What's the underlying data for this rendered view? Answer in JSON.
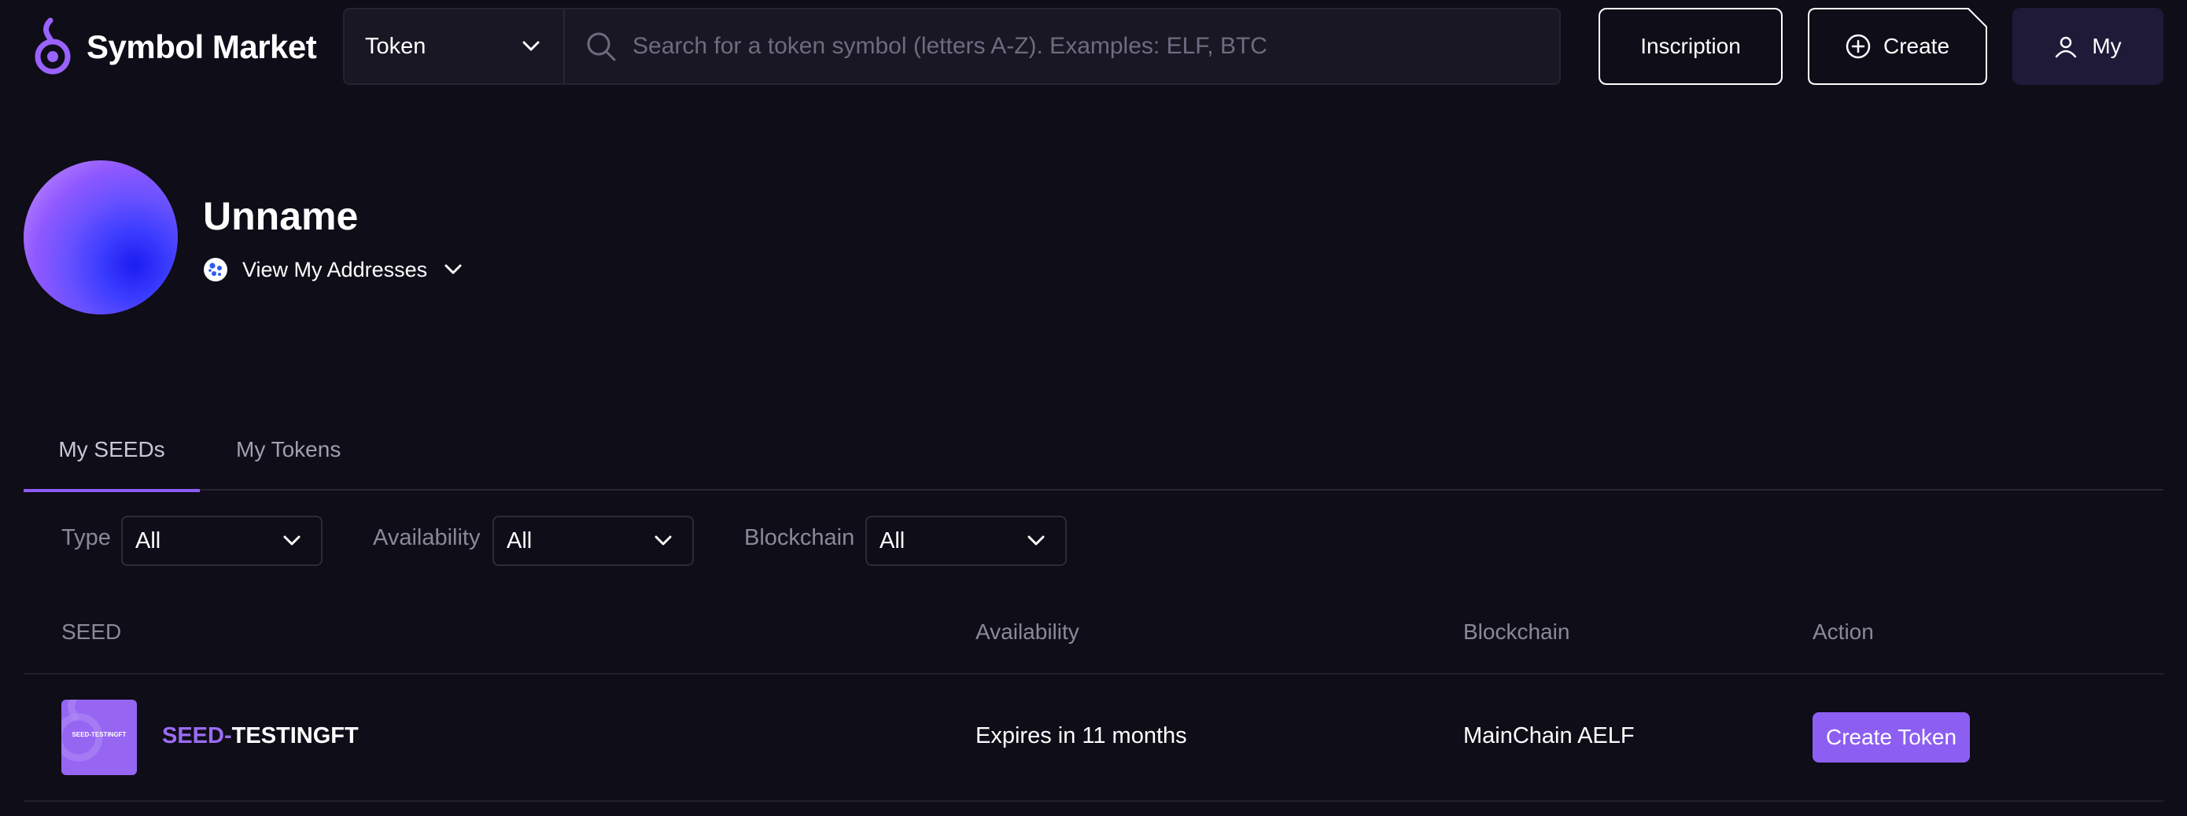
{
  "app": {
    "name": "Symbol Market"
  },
  "colors": {
    "background": "#0f0d17",
    "accent": "#8c5ff2",
    "seed_prefix": "#9b6cf6",
    "muted_text": "#8b889a"
  },
  "header": {
    "search": {
      "type_selected": "Token",
      "placeholder": "Search for a token symbol (letters A-Z). Examples: ELF, BTC"
    },
    "inscription_label": "Inscription",
    "create_label": "Create",
    "my_label": "My",
    "icons": [
      "symbol-market-logo",
      "chevron-down-icon",
      "search-icon",
      "plus-circle-icon",
      "user-icon"
    ]
  },
  "profile": {
    "name": "Unname",
    "addresses_label": "View My Addresses"
  },
  "tabs": [
    {
      "label": "My SEEDs",
      "active": true
    },
    {
      "label": "My Tokens",
      "active": false
    }
  ],
  "filters": [
    {
      "label": "Type",
      "value": "All"
    },
    {
      "label": "Availability",
      "value": "All"
    },
    {
      "label": "Blockchain",
      "value": "All"
    }
  ],
  "table": {
    "columns": [
      "SEED",
      "Availability",
      "Blockchain",
      "Action"
    ],
    "rows": [
      {
        "thumb_text": "SEED-TESTINGFT",
        "seed_prefix": "SEED-",
        "seed_symbol": "TESTINGFT",
        "availability": "Expires in 11 months",
        "blockchain": "MainChain AELF",
        "action": "Create Token"
      }
    ]
  }
}
